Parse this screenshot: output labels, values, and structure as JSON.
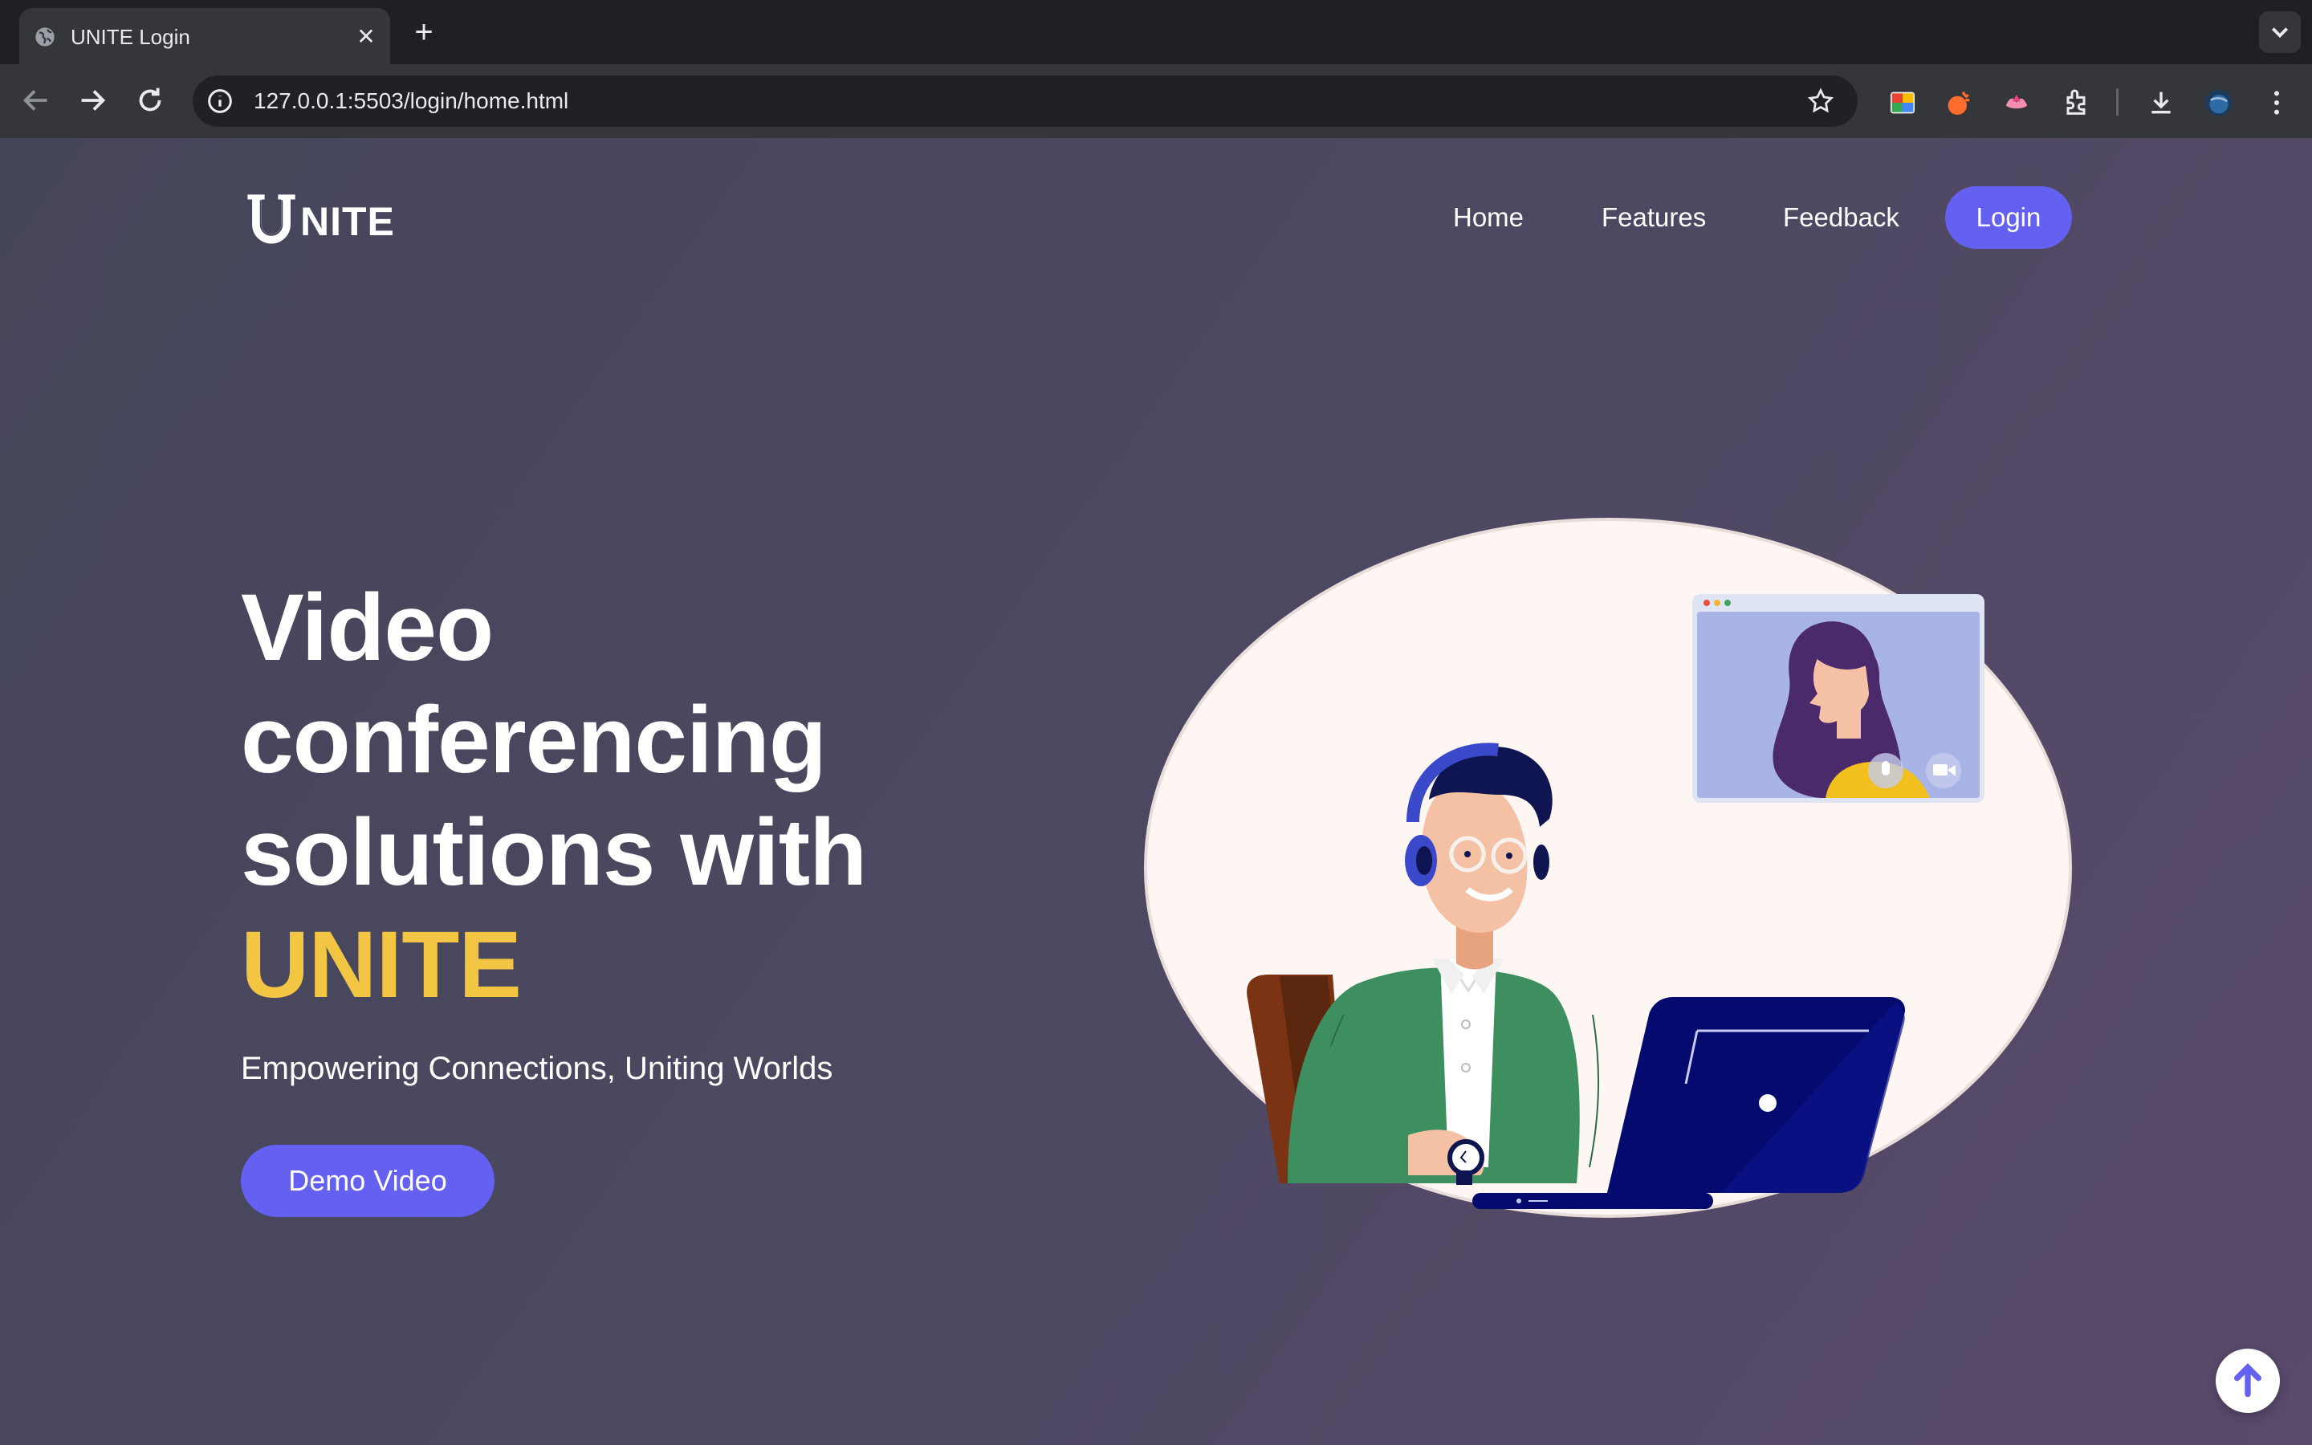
{
  "browser": {
    "tab_title": "UNITE Login",
    "address": "127.0.0.1:5503/login/home.html"
  },
  "page": {
    "logo_text": "NITE",
    "logo_emblem_letter": "U",
    "nav": {
      "home": "Home",
      "features": "Features",
      "feedback": "Feedback",
      "login": "Login"
    },
    "hero": {
      "line1": "Video",
      "line2": "conferencing",
      "line3": "solutions with",
      "accent": "UNITE",
      "tagline": "Empowering Connections, Uniting Worlds",
      "demo_button": "Demo Video"
    },
    "colors": {
      "accent_yellow": "#f2c542",
      "button_purple": "#6461f2",
      "bg_start": "#45455a",
      "bg_end": "#5a4a6c"
    },
    "icons": [
      "globe-icon",
      "close-icon",
      "plus-icon",
      "back-icon",
      "forward-icon",
      "reload-icon",
      "site-info-icon",
      "bookmark-star-icon",
      "extensions-icon",
      "download-icon",
      "more-menu-icon",
      "arrow-up-icon"
    ]
  }
}
